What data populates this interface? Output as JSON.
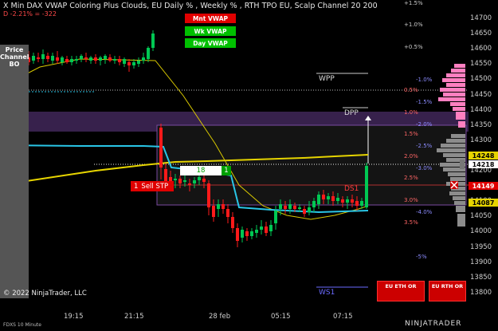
{
  "header": {
    "title": "X Min DAX VWAP Coloring Plus Clouds, EU Daily % , Weekly % , RTH TPO EU, Scalp Channel 20  200",
    "change": "D -2.21% = -322"
  },
  "vwap_buttons": {
    "mnt": "Mnt VWAP",
    "wk": "Wk VWAP",
    "day": "Day VWAP"
  },
  "price_channel_label": "Price\nChannel\nBO",
  "levels": {
    "wpp": "WPP",
    "dpp": "DPP",
    "ws1": "WS1",
    "ds1": "DS1"
  },
  "order": {
    "qty": "1",
    "label": "Sell STP"
  },
  "position": {
    "value": "18",
    "qty": "1"
  },
  "right_axis": {
    "prices": [
      "14700",
      "14650",
      "14600",
      "14550",
      "14500",
      "14450",
      "14400",
      "14350",
      "14300",
      "14250",
      "14200",
      "14150",
      "14100",
      "14050",
      "14000",
      "13950",
      "13900",
      "13850",
      "13800"
    ],
    "tags": {
      "upper": "14248",
      "current": "14218",
      "stop": "14149",
      "lower": "14087"
    }
  },
  "weekly_pct": [
    "+1.5%",
    "+1.0%",
    "+0.5%",
    "-1.0%",
    "-1.5%",
    "-2.0%",
    "-2.5%",
    "-3.0%",
    "-4.0%",
    "-5%"
  ],
  "daily_pct": [
    "0.5%",
    "1.0%",
    "1.5%",
    "2.0%",
    "2.5%",
    "3.0%",
    "3.5%"
  ],
  "time_axis": [
    "19:15",
    "21:15",
    "28 feb",
    "05:15",
    "07:15"
  ],
  "eu_boxes": {
    "eth": "EU ETH OR",
    "rth": "EU RTH OR"
  },
  "footer": {
    "symbol": "FDXS 10 Minute",
    "copyright": "© 2022 NinjaTrader, LLC",
    "logo": "NINJATRADER"
  },
  "colors": {
    "up_candle": "#00c853",
    "down_candle": "#ff1a1a",
    "vwap_yellow": "#e6d400",
    "vwap_cyan": "#29c5e6",
    "tpo_pink": "#ff7fc0",
    "tpo_gray": "#8c8c8c",
    "cloud_purple": "#3a2350"
  }
}
